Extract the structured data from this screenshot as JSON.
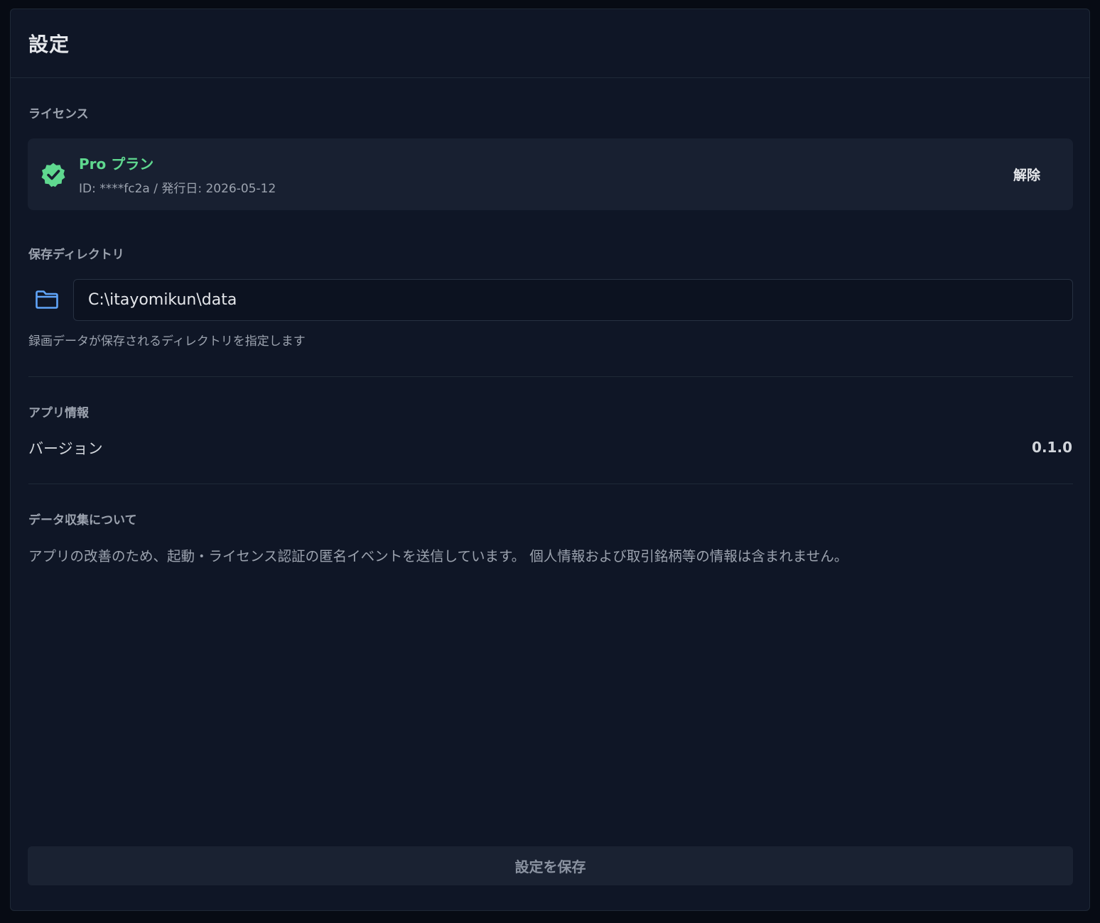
{
  "header": {
    "title": "設定"
  },
  "license": {
    "section_label": "ライセンス",
    "plan_name": "Pro プラン",
    "meta": "ID: ****fc2a / 発行日: 2026-05-12",
    "release_label": "解除",
    "badge_icon": "verified-badge-icon",
    "accent_color": "#5fd88f"
  },
  "storage": {
    "section_label": "保存ディレクトリ",
    "folder_icon": "folder-icon",
    "path_value": "C:\\itayomikun\\data",
    "hint": "録画データが保存されるディレクトリを指定します",
    "icon_color": "#60a5fa"
  },
  "app_info": {
    "section_label": "アプリ情報",
    "version_label": "バージョン",
    "version_value": "0.1.0"
  },
  "telemetry": {
    "section_label": "データ収集について",
    "text": "アプリの改善のため、起動・ライセンス認証の匿名イベントを送信しています。 個人情報および取引銘柄等の情報は含まれません。"
  },
  "footer": {
    "save_label": "設定を保存"
  }
}
